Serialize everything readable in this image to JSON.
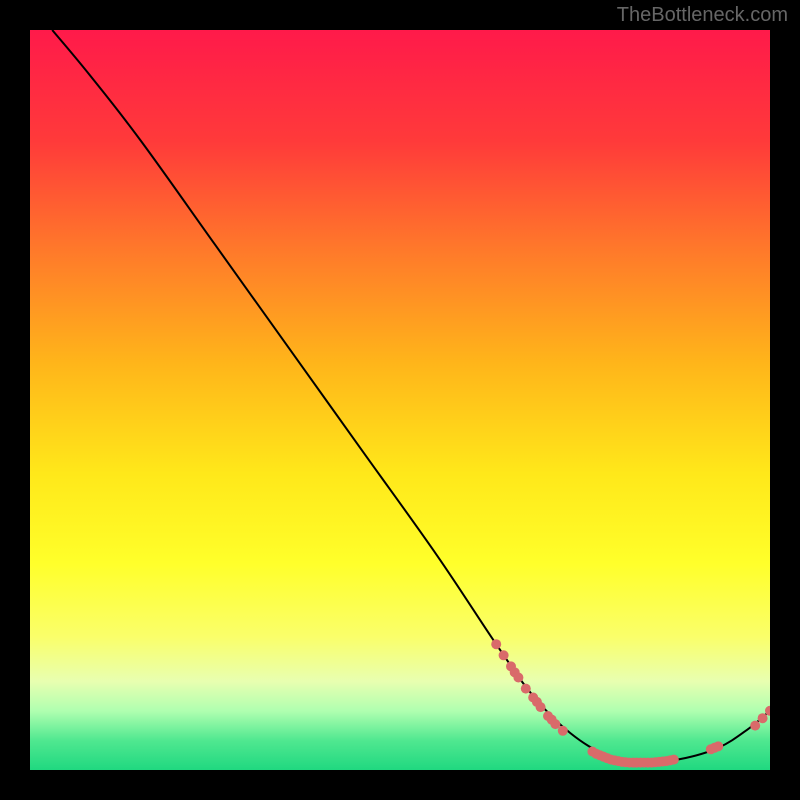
{
  "watermark": "TheBottleneck.com",
  "chart_data": {
    "type": "line",
    "title": "",
    "xlabel": "",
    "ylabel": "",
    "xlim": [
      0,
      100
    ],
    "ylim": [
      0,
      100
    ],
    "curve": [
      {
        "x": 3,
        "y": 100
      },
      {
        "x": 8,
        "y": 94
      },
      {
        "x": 15,
        "y": 85
      },
      {
        "x": 25,
        "y": 71
      },
      {
        "x": 35,
        "y": 57
      },
      {
        "x": 45,
        "y": 43
      },
      {
        "x": 55,
        "y": 29
      },
      {
        "x": 63,
        "y": 17
      },
      {
        "x": 68,
        "y": 10
      },
      {
        "x": 73,
        "y": 5
      },
      {
        "x": 78,
        "y": 2
      },
      {
        "x": 83,
        "y": 1
      },
      {
        "x": 88,
        "y": 1.5
      },
      {
        "x": 93,
        "y": 3
      },
      {
        "x": 97,
        "y": 5.5
      },
      {
        "x": 100,
        "y": 8
      }
    ],
    "scatter_points": [
      {
        "x": 63,
        "y": 17
      },
      {
        "x": 64,
        "y": 15.5
      },
      {
        "x": 65,
        "y": 14
      },
      {
        "x": 65.5,
        "y": 13.2
      },
      {
        "x": 66,
        "y": 12.5
      },
      {
        "x": 67,
        "y": 11
      },
      {
        "x": 68,
        "y": 9.8
      },
      {
        "x": 68.5,
        "y": 9.2
      },
      {
        "x": 69,
        "y": 8.5
      },
      {
        "x": 70,
        "y": 7.3
      },
      {
        "x": 70.5,
        "y": 6.8
      },
      {
        "x": 71,
        "y": 6.2
      },
      {
        "x": 72,
        "y": 5.3
      },
      {
        "x": 76,
        "y": 2.5
      },
      {
        "x": 76.5,
        "y": 2.2
      },
      {
        "x": 77,
        "y": 2
      },
      {
        "x": 77.5,
        "y": 1.8
      },
      {
        "x": 78,
        "y": 1.6
      },
      {
        "x": 78.5,
        "y": 1.4
      },
      {
        "x": 79,
        "y": 1.3
      },
      {
        "x": 79.5,
        "y": 1.2
      },
      {
        "x": 80,
        "y": 1.1
      },
      {
        "x": 80.5,
        "y": 1.05
      },
      {
        "x": 81,
        "y": 1
      },
      {
        "x": 81.5,
        "y": 1
      },
      {
        "x": 82,
        "y": 1
      },
      {
        "x": 82.5,
        "y": 1
      },
      {
        "x": 83,
        "y": 1
      },
      {
        "x": 83.5,
        "y": 1
      },
      {
        "x": 84,
        "y": 1
      },
      {
        "x": 84.5,
        "y": 1.05
      },
      {
        "x": 85,
        "y": 1.1
      },
      {
        "x": 85.5,
        "y": 1.15
      },
      {
        "x": 86,
        "y": 1.2
      },
      {
        "x": 86.5,
        "y": 1.3
      },
      {
        "x": 87,
        "y": 1.4
      },
      {
        "x": 92,
        "y": 2.8
      },
      {
        "x": 92.5,
        "y": 3
      },
      {
        "x": 93,
        "y": 3.2
      },
      {
        "x": 98,
        "y": 6
      },
      {
        "x": 99,
        "y": 7
      },
      {
        "x": 100,
        "y": 8
      }
    ],
    "gradient_stops": [
      {
        "offset": 0,
        "color": "#ff1a4a"
      },
      {
        "offset": 15,
        "color": "#ff3a3a"
      },
      {
        "offset": 30,
        "color": "#ff7a2a"
      },
      {
        "offset": 45,
        "color": "#ffb51a"
      },
      {
        "offset": 60,
        "color": "#ffe81a"
      },
      {
        "offset": 72,
        "color": "#ffff2a"
      },
      {
        "offset": 82,
        "color": "#faff6a"
      },
      {
        "offset": 88,
        "color": "#e8ffb0"
      },
      {
        "offset": 92,
        "color": "#b0ffb0"
      },
      {
        "offset": 96,
        "color": "#50e890"
      },
      {
        "offset": 100,
        "color": "#20d880"
      }
    ],
    "curve_color": "#000000",
    "point_color": "#d96a6a",
    "point_radius": 5
  }
}
